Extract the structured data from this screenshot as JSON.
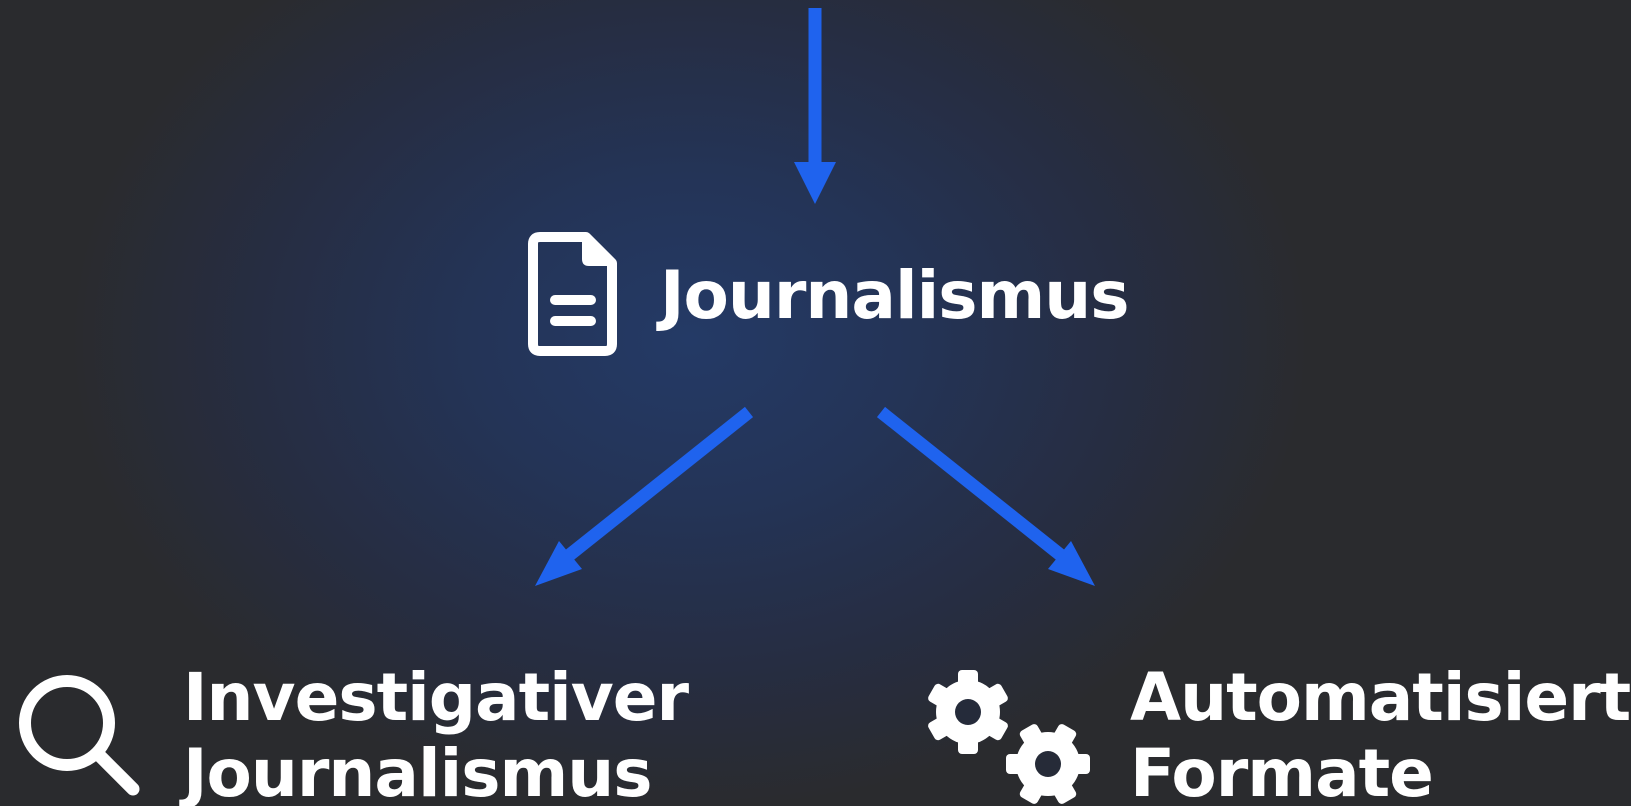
{
  "nodes": {
    "main": {
      "label": "Journalismus",
      "icon": "document-icon"
    },
    "left": {
      "line1": "Investigativer",
      "line2": "Journalismus",
      "icon": "search-icon"
    },
    "right": {
      "line1": "Automatisierte",
      "line2": "Formate",
      "icon": "gears-icon"
    }
  },
  "colors": {
    "arrow": "#1f63ee",
    "text": "#ffffff",
    "background": "#2a2b2e",
    "glow": "#243a66"
  }
}
